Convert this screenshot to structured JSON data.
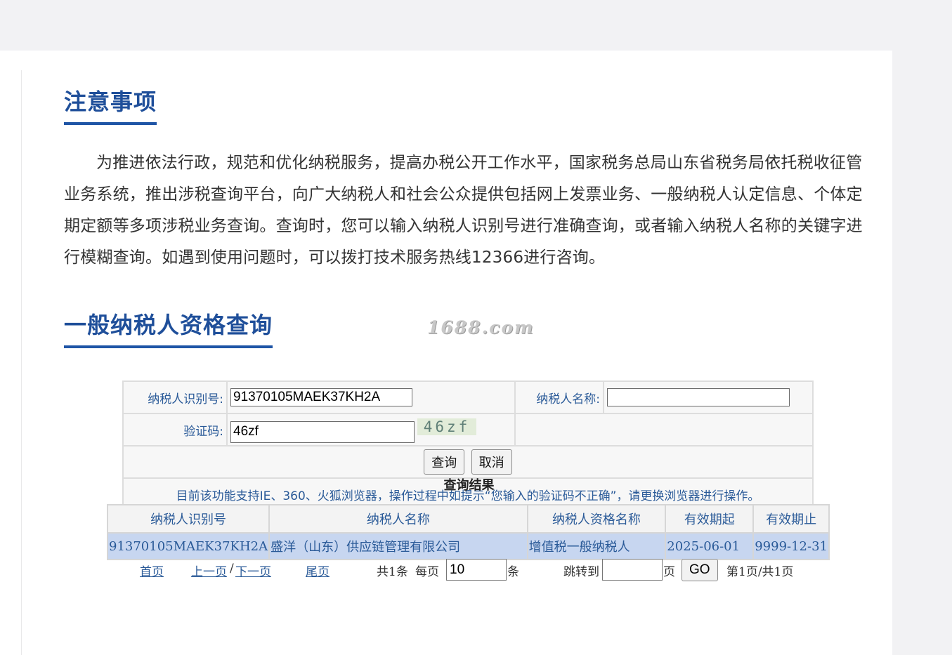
{
  "notice_section": {
    "title": "注意事项",
    "paragraph": "为推进依法行政，规范和优化纳税服务，提高办税公开工作水平，国家税务总局山东省税务局依托税收征管业务系统，推出涉税查询平台，向广大纳税人和社会公众提供包括网上发票业务、一般纳税人认定信息、个体定期定额等多项涉税业务查询。查询时，您可以输入纳税人识别号进行准确查询，或者输入纳税人名称的关键字进行模糊查询。如遇到使用问题时，可以拨打技术服务热线12366进行咨询。"
  },
  "query_section": {
    "title": "一般纳税人资格查询",
    "watermark": "1688.com"
  },
  "form": {
    "taxpayer_id_label": "纳税人识别号:",
    "taxpayer_id_value": "91370105MAEK37KH2A",
    "taxpayer_name_label": "纳税人名称:",
    "taxpayer_name_value": "",
    "captcha_label": "验证码:",
    "captcha_value": "46zf",
    "captcha_image_text": "46zf",
    "query_button": "查询",
    "cancel_button": "取消",
    "browser_notice": "目前该功能支持IE、360、火狐浏览器，操作过程中如提示“您输入的验证码不正确”，请更换浏览器进行操作。"
  },
  "results": {
    "title": "查询结果",
    "columns": [
      "纳税人识别号",
      "纳税人名称",
      "纳税人资格名称",
      "有效期起",
      "有效期止"
    ],
    "rows": [
      [
        "91370105MAEK37KH2A",
        "盛洋（山东）供应链管理有限公司",
        "增值税一般纳税人",
        "2025-06-01",
        "9999-12-31"
      ]
    ]
  },
  "pager": {
    "first": "首页",
    "prev": "上一页",
    "separator": "/",
    "next": "下一页",
    "last": "尾页",
    "total": "共1条",
    "per_page_label": "每页",
    "per_page_value": "10",
    "per_page_unit": "条",
    "jump_label": "跳转到",
    "jump_value": "",
    "jump_unit": "页",
    "go_button": "GO",
    "page_status": "第1页/共1页"
  }
}
